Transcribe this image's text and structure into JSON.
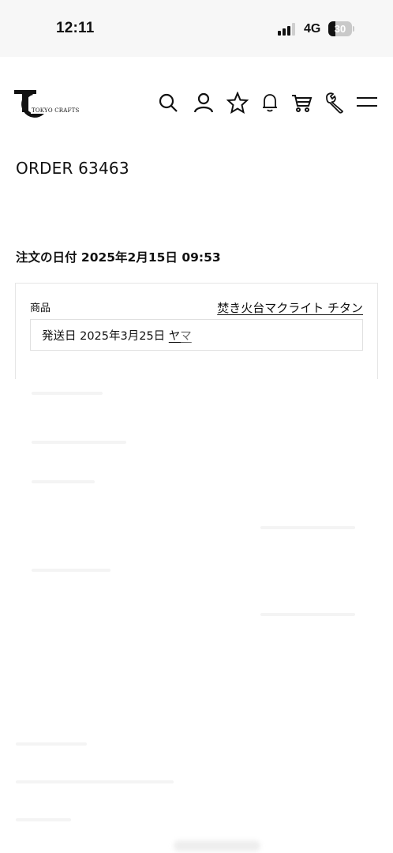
{
  "status_bar": {
    "time": "12:11",
    "network": "4G",
    "battery": {
      "level": 30,
      "label": "30"
    }
  },
  "header": {
    "logo_text": "TOKYO CRAFTS",
    "icons": [
      "search-icon",
      "account-icon",
      "favorites-star-icon",
      "notification-bell-icon",
      "cart-icon",
      "wrench-icon",
      "menu-icon"
    ]
  },
  "order": {
    "title": "ORDER 63463",
    "date_label": "注文の日付",
    "date_value": "2025年2月15日 09:53"
  },
  "product": {
    "label": "商品",
    "name": "焚き火台マクライト チタン",
    "shipping_date": "発送日 2025年3月25日",
    "carrier_partial": "ヤマ"
  },
  "colors": {
    "text": "#111111",
    "border": "#e6e6e6",
    "status_bg": "#f7f7f7"
  }
}
